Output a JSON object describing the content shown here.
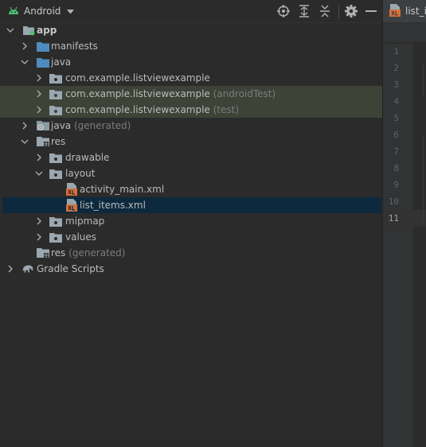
{
  "toolbar": {
    "view_label": "Android",
    "icons": [
      "android-icon",
      "chevron-down-icon",
      "crosshair-icon",
      "expand-all-icon",
      "collapse-all-icon",
      "gear-icon",
      "minimize-icon"
    ]
  },
  "tree": [
    {
      "label": "app",
      "suffix": "",
      "bold": true
    },
    {
      "label": "manifests",
      "suffix": ""
    },
    {
      "label": "java",
      "suffix": ""
    },
    {
      "label": "com.example.listviewexample",
      "suffix": ""
    },
    {
      "label": "com.example.listviewexample",
      "suffix": "(androidTest)"
    },
    {
      "label": "com.example.listviewexample",
      "suffix": "(test)"
    },
    {
      "label": "java",
      "suffix": "(generated)"
    },
    {
      "label": "res",
      "suffix": ""
    },
    {
      "label": "drawable",
      "suffix": ""
    },
    {
      "label": "layout",
      "suffix": ""
    },
    {
      "label": "activity_main.xml",
      "suffix": ""
    },
    {
      "label": "list_items.xml",
      "suffix": ""
    },
    {
      "label": "mipmap",
      "suffix": ""
    },
    {
      "label": "values",
      "suffix": ""
    },
    {
      "label": "res",
      "suffix": "(generated)"
    },
    {
      "label": "Gradle Scripts",
      "suffix": ""
    }
  ],
  "editor": {
    "tab_label": "list_it",
    "line_numbers": [
      "1",
      "2",
      "3",
      "4",
      "5",
      "6",
      "7",
      "8",
      "9",
      "10",
      "11"
    ],
    "current_line": "11"
  },
  "colors": {
    "background": "#2b2b2b",
    "selection": "#0d293e",
    "test_highlight": "#3d4337",
    "folder_blue": "#4e8bbf",
    "xml_orange": "#d5713b",
    "android_green": "#4fbf74"
  }
}
